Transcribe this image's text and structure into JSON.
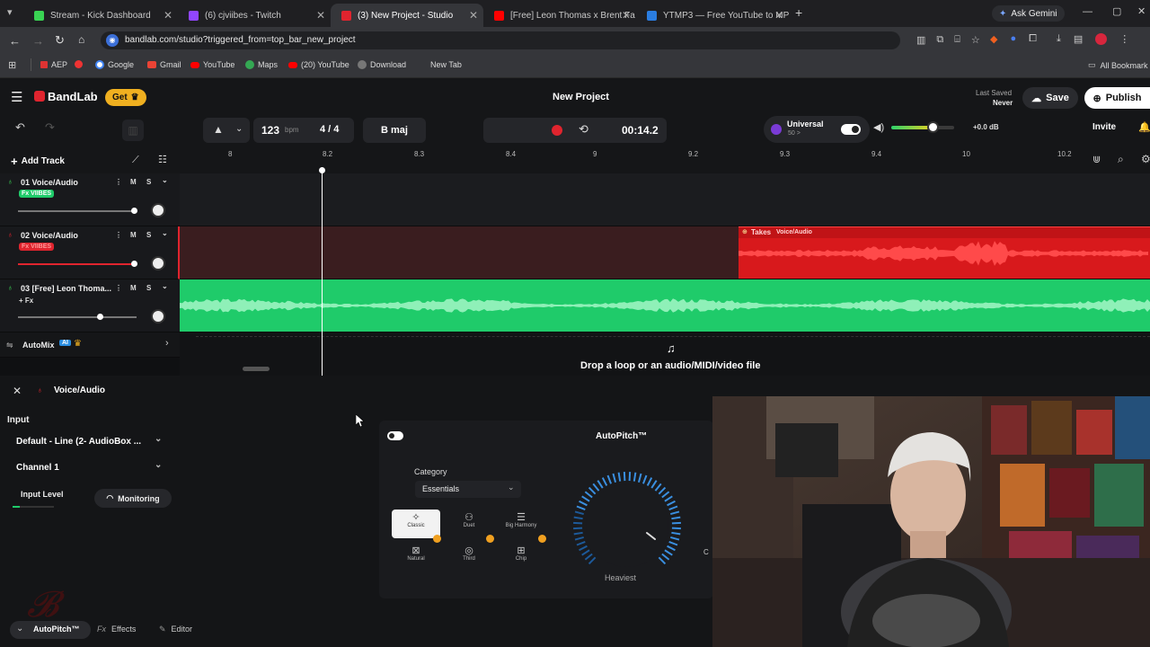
{
  "browser": {
    "tabs": [
      {
        "title": "Stream - Kick Dashboard",
        "color": "#39d353",
        "active": false
      },
      {
        "title": "(6) cjviibes - Twitch",
        "color": "#9146ff",
        "active": false
      },
      {
        "title": "(3) New Project - Studio",
        "color": "#e0242e",
        "active": true
      },
      {
        "title": "[Free] Leon Thomas x Brent Fa",
        "color": "#ff0000",
        "active": false
      },
      {
        "title": "YTMP3 — Free YouTube to MP",
        "color": "#2a7de1",
        "active": false
      }
    ],
    "new_tab": "+",
    "ask_gemini": "Ask Gemini",
    "url": "bandlab.com/studio?triggered_from=top_bar_new_project",
    "bookmarks": [
      {
        "label": "AEP",
        "color": "#d33"
      },
      {
        "label": "",
        "color": "#e33"
      },
      {
        "label": "Google",
        "color": "#4285f4"
      },
      {
        "label": "Gmail",
        "color": "#ea4335"
      },
      {
        "label": "YouTube",
        "color": "#ff0000"
      },
      {
        "label": "Maps",
        "color": "#34a853"
      },
      {
        "label": "(20) YouTube",
        "color": "#ff0000"
      },
      {
        "label": "Download",
        "color": "#888"
      },
      {
        "label": "New Tab",
        "color": ""
      }
    ],
    "all_bookmarks": "All Bookmark"
  },
  "header": {
    "brand": "BandLab",
    "get_button": "Get",
    "project_title": "New Project",
    "last_saved_label": "Last Saved",
    "last_saved_value": "Never",
    "save": "Save",
    "publish": "Publish"
  },
  "toolbar": {
    "tempo": "123",
    "tempo_unit": "bpm",
    "time_sig": "4 / 4",
    "key": "B maj",
    "time": "00:14.2",
    "preset_name": "Universal",
    "preset_sub": "50 >",
    "volume_db": "+0.0 dB",
    "invite": "Invite"
  },
  "tracks_header": {
    "add_track": "Add Track"
  },
  "ruler": [
    "8",
    "8.2",
    "8.3",
    "8.4",
    "9",
    "9.2",
    "9.3",
    "9.4",
    "10",
    "10.2"
  ],
  "tracks": [
    {
      "name": "01  Voice/Audio",
      "fx": "Fx VIIBES",
      "color": "#39d353",
      "m": "M",
      "s": "S"
    },
    {
      "name": "02  Voice/Audio",
      "fx": "Fx VIIBES",
      "color": "#e0242e",
      "m": "M",
      "s": "S"
    },
    {
      "name": "03  [Free] Leon Thoma...",
      "fx": "+ Fx",
      "color": "#39d353",
      "m": "M",
      "s": "S"
    }
  ],
  "automix": {
    "label": "AutoMix",
    "ai": "AI"
  },
  "takes": {
    "label": "Takes",
    "sub": "Voice/Audio"
  },
  "drop_hint": "Drop a loop or an audio/MIDI/video file",
  "panel": {
    "track_name": "Voice/Audio",
    "input_label": "Input",
    "input_device": "Default - Line (2- AudioBox ...",
    "channel": "Channel 1",
    "input_level": "Input Level",
    "monitoring": "Monitoring",
    "tabs": [
      "AutoPitch™",
      "Effects",
      "Editor"
    ]
  },
  "autopitch": {
    "title": "AutoPitch™",
    "category_label": "Category",
    "category_value": "Essentials",
    "presets": [
      {
        "label": "Classic",
        "icon": "✧",
        "selected": true,
        "premium": false
      },
      {
        "label": "Duet",
        "icon": "⚇",
        "selected": false,
        "premium": false
      },
      {
        "label": "Big Harmony",
        "icon": "☰",
        "selected": false,
        "premium": false
      },
      {
        "label": "Natural",
        "icon": "⊠",
        "selected": false,
        "premium": true
      },
      {
        "label": "Third",
        "icon": "◎",
        "selected": false,
        "premium": true
      },
      {
        "label": "Chip",
        "icon": "⊞",
        "selected": false,
        "premium": true
      }
    ],
    "knob_label": "Heaviest",
    "side_letter": "C"
  },
  "colors": {
    "red": "#e0242e",
    "green": "#1fcb6a",
    "accent_blue": "#2a8de1",
    "gold": "#f0b020"
  }
}
